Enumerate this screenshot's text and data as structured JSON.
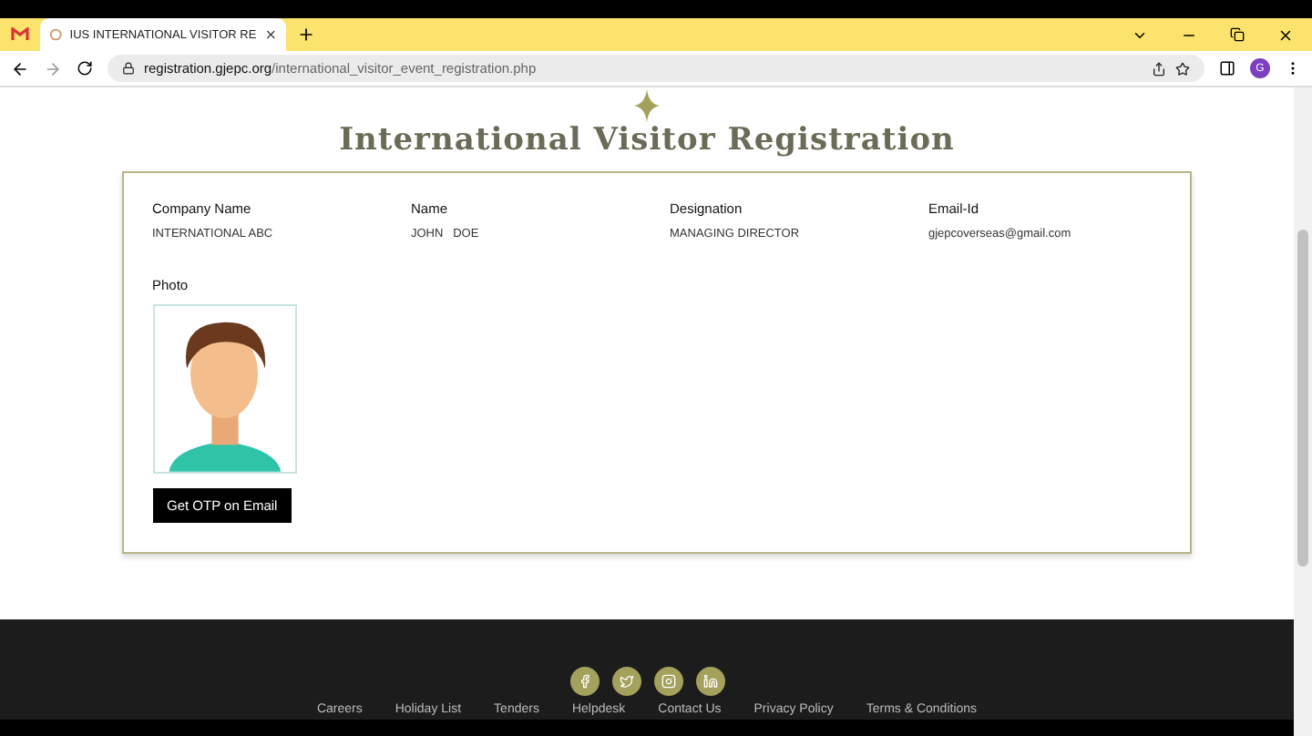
{
  "browser": {
    "tab_title": "IUS INTERNATIONAL VISITOR RE",
    "url_host": "registration.gjepc.org",
    "url_path": "/international_visitor_event_registration.php",
    "profile_initial": "G"
  },
  "page": {
    "title": "International Visitor Registration",
    "fields": [
      {
        "label": "Company Name",
        "value": "INTERNATIONAL ABC"
      },
      {
        "label": "Name",
        "value": "JOHN   DOE"
      },
      {
        "label": "Designation",
        "value": "MANAGING DIRECTOR"
      },
      {
        "label": "Email-Id",
        "value": "gjepcoverseas@gmail.com"
      }
    ],
    "photo_label": "Photo",
    "otp_button": "Get OTP on Email"
  },
  "footer": {
    "social": [
      {
        "kind": "facebook"
      },
      {
        "kind": "twitter"
      },
      {
        "kind": "instagram"
      },
      {
        "kind": "linkedin"
      }
    ],
    "links": [
      "Careers",
      "Holiday List",
      "Tenders",
      "Helpdesk",
      "Contact Us",
      "Privacy Policy",
      "Terms & Conditions"
    ]
  }
}
